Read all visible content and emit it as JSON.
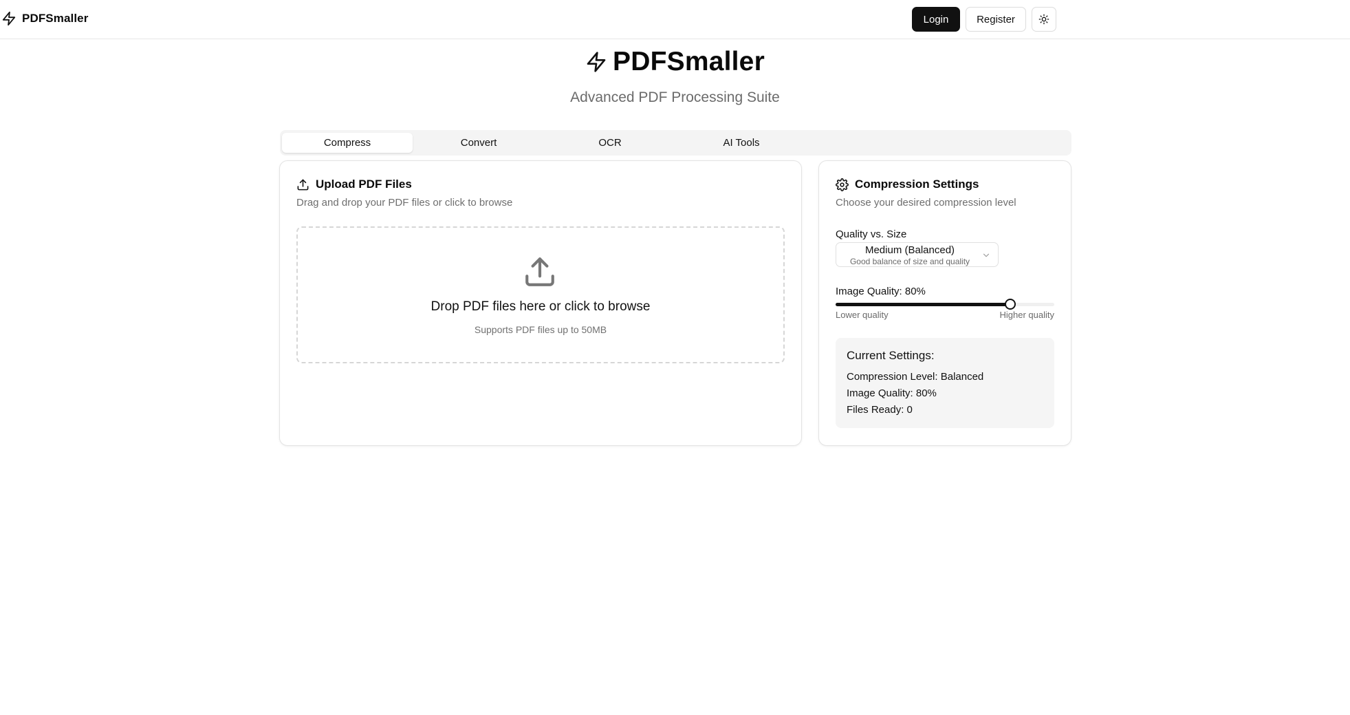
{
  "header": {
    "brand": "PDFSmaller",
    "login_label": "Login",
    "register_label": "Register"
  },
  "hero": {
    "title": "PDFSmaller",
    "subtitle": "Advanced PDF Processing Suite"
  },
  "tabs": [
    {
      "label": "Compress",
      "active": true
    },
    {
      "label": "Convert",
      "active": false
    },
    {
      "label": "OCR",
      "active": false
    },
    {
      "label": "AI Tools",
      "active": false
    }
  ],
  "upload": {
    "title": "Upload PDF Files",
    "description": "Drag and drop your PDF files or click to browse",
    "drop_title": "Drop PDF files here or click to browse",
    "drop_subtitle": "Supports PDF files up to 50MB"
  },
  "settings": {
    "title": "Compression Settings",
    "description": "Choose your desired compression level",
    "quality_size_label": "Quality vs. Size",
    "select_value": "Medium (Balanced)",
    "select_description": "Good balance of size and quality",
    "image_quality_label": "Image Quality: 80%",
    "image_quality_value": 80,
    "slider_min_label": "Lower quality",
    "slider_max_label": "Higher quality"
  },
  "summary": {
    "title": "Current Settings:",
    "compression_level": "Compression Level: Balanced",
    "image_quality": "Image Quality: 80%",
    "files_ready": "Files Ready: 0"
  },
  "colors": {
    "primary": "#111111",
    "muted_text": "#6e6e6e",
    "border": "#e3e3e3",
    "muted_bg": "#f5f5f5"
  },
  "icons": {
    "brand": "zap-icon",
    "theme_toggle": "sun-icon",
    "upload": "upload-icon",
    "settings": "gear-icon",
    "select": "chevron-down-icon"
  }
}
